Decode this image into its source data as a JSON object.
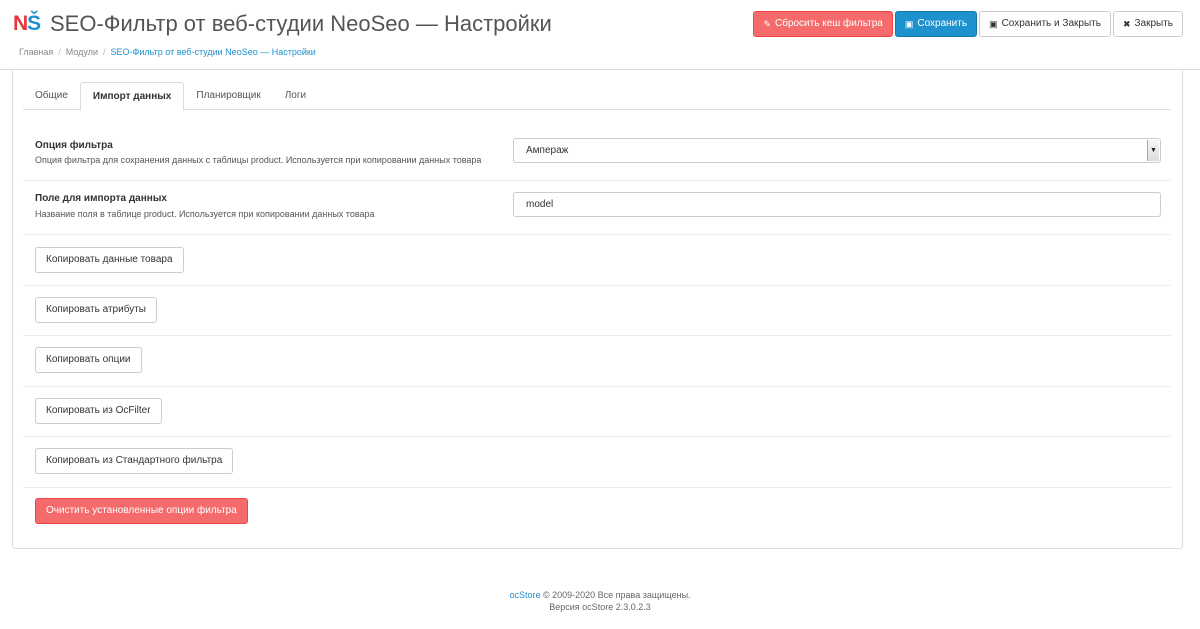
{
  "header": {
    "logo_n": "N",
    "logo_s": "Š",
    "title": "SEO-Фильтр от веб-студии NeoSeo — Настройки",
    "buttons": {
      "reset_cache": "Сбросить кеш фильтра",
      "save": "Сохранить",
      "save_close": "Сохранить и Закрыть",
      "close": "Закрыть"
    },
    "icons": {
      "reset_cache": "eraser-icon",
      "save": "floppy-icon",
      "save_close": "floppy-icon",
      "close": "close-icon"
    }
  },
  "breadcrumb": {
    "items": [
      "Главная",
      "Модули",
      "SEO-Фильтр от веб-студии NeoSeo — Настройки"
    ],
    "separator": "/"
  },
  "tabs": [
    "Общие",
    "Импорт данных",
    "Планировщик",
    "Логи"
  ],
  "active_tab": "Импорт данных",
  "form": {
    "filter_option": {
      "label": "Опция фильтра",
      "help": "Опция фильтра для сохранения данных с таблицы product. Используется при копировании данных товара",
      "value": "Ампераж"
    },
    "import_field": {
      "label": "Поле для импорта данных",
      "help": "Название поля в таблице product. Используется при копировании данных товара",
      "value": "model"
    }
  },
  "actions": {
    "copy_product": "Копировать данные товара",
    "copy_attributes": "Копировать атрибуты",
    "copy_options": "Копировать опции",
    "copy_ocfilter": "Копировать из OcFilter",
    "copy_standard": "Копировать из Стандартного фильтра",
    "clear_options": "Очистить установленные опции фильтра"
  },
  "footer": {
    "brand": "ocStore",
    "copyright": "© 2009-2020 Все права защищены.",
    "version": "Версия ocStore 2.3.0.2.3"
  },
  "colors": {
    "primary": "#1e91cf",
    "danger": "#f56b6b",
    "logo_red": "#e8363a"
  }
}
